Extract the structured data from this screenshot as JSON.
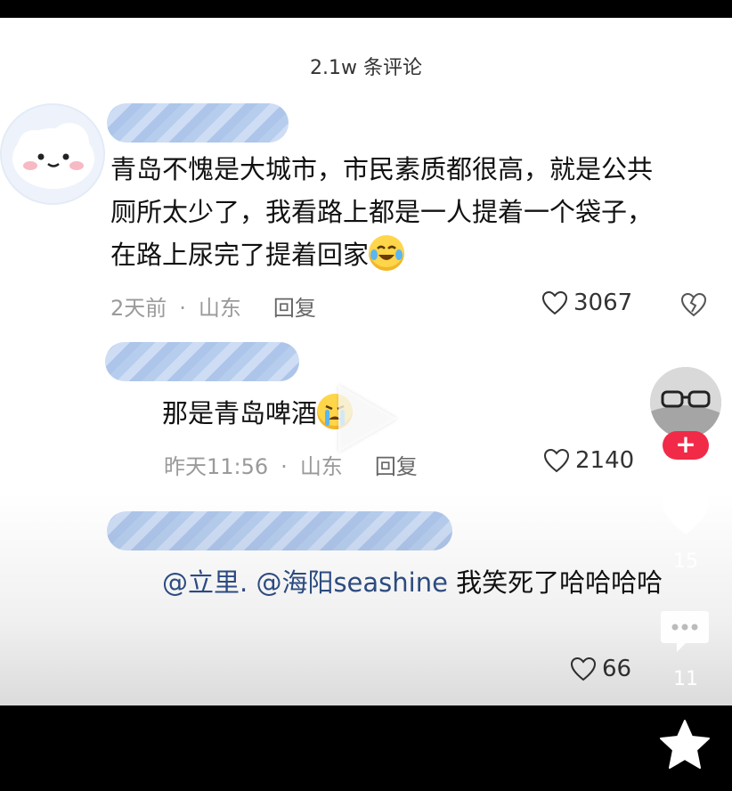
{
  "header": {
    "comment_count": "2.1w 条评论"
  },
  "comments": [
    {
      "text_lines": [
        "青岛不愧是大城市，市民素质都很高，就是公共",
        "厕所太少了，我看路上都是一人提着一个袋子，",
        "在路上尿完了提着回家"
      ],
      "emoji": "crying-laughing-emoji",
      "time": "2天前",
      "location": "山东",
      "reply_label": "回复",
      "likes": "3067"
    },
    {
      "text": "那是青岛啤酒",
      "emoji": "crying-emoji",
      "time": "昨天11:56",
      "location": "山东",
      "reply_label": "回复",
      "likes": "2140"
    },
    {
      "mention1": "@立里.",
      "mention2": "@海阳seashine",
      "text": " 我笑死了哈哈哈哈",
      "likes": "66"
    }
  ],
  "right_rail": {
    "like_count": "15",
    "comment_count": "11",
    "follow_icon": "plus-icon",
    "like_icon": "heart-icon",
    "comment_icon": "comment-bubble-icon",
    "favorite_icon": "star-icon"
  },
  "colors": {
    "follow_button": "#f12a48",
    "mention": "#2e4e86",
    "avatar_blur": "#a9c4ea"
  }
}
